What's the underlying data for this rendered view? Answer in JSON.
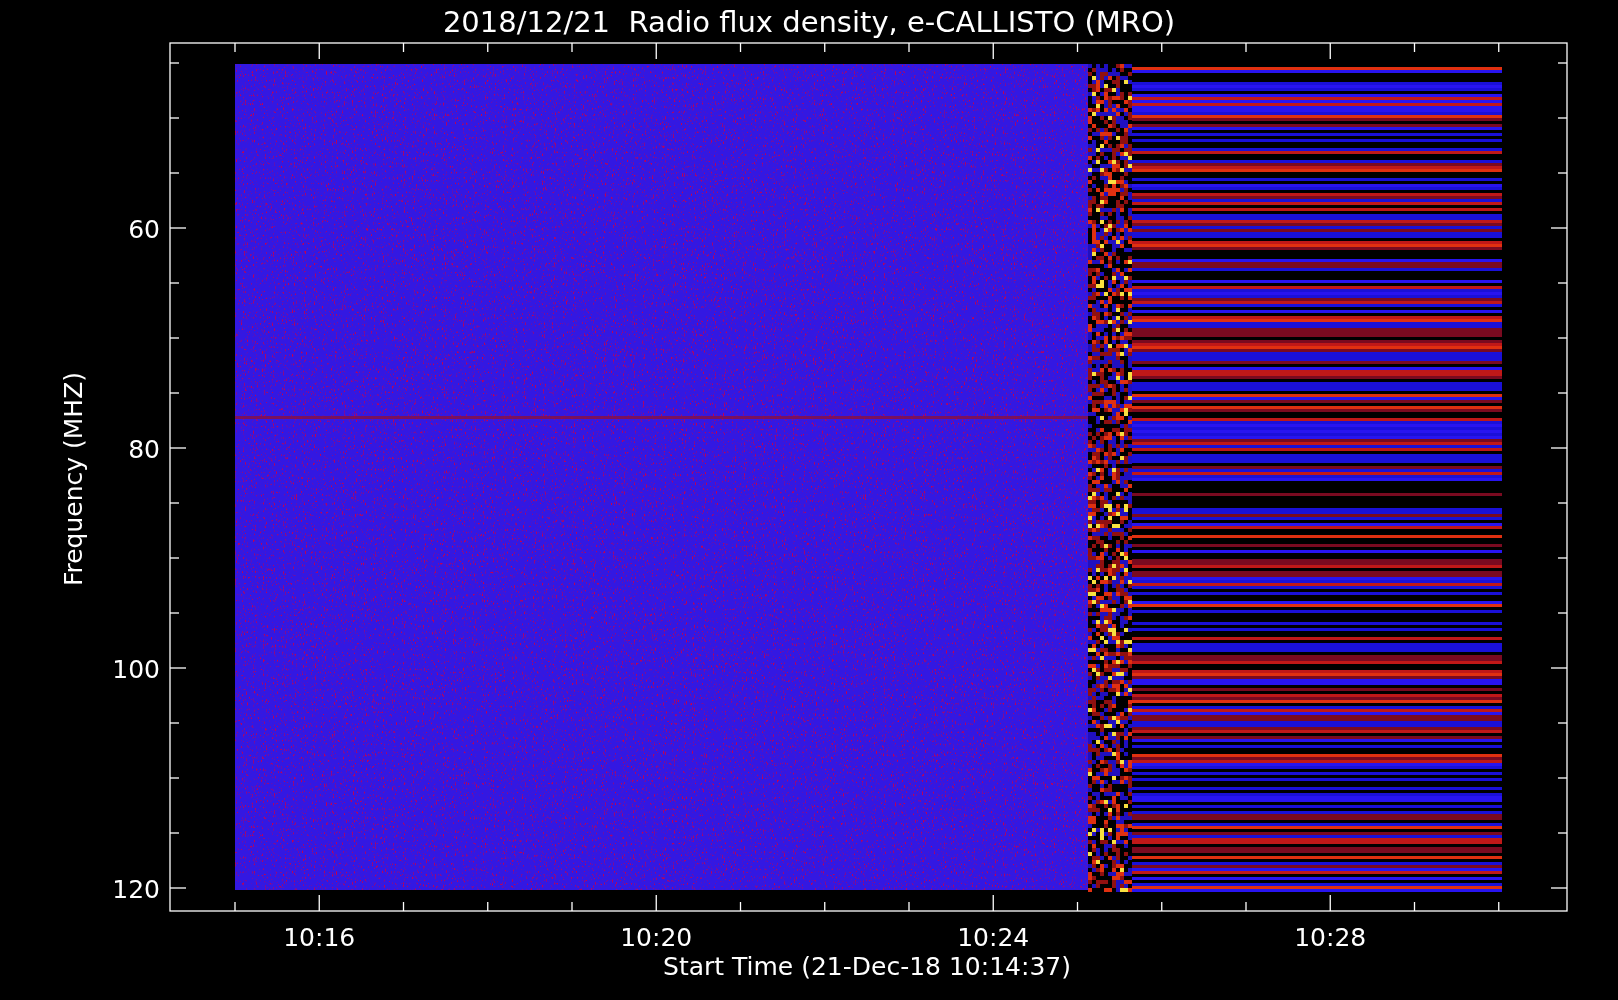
{
  "title": "2018/12/21  Radio flux density, e-CALLISTO (MRO)",
  "y_axis": {
    "label": "Frequency (MHZ)",
    "ticks": [
      "60",
      "80",
      "100",
      "120"
    ]
  },
  "x_axis": {
    "label": "Start Time (21-Dec-18 10:14:37)",
    "ticks": [
      "10:16",
      "10:20",
      "10:24",
      "10:28"
    ]
  }
}
